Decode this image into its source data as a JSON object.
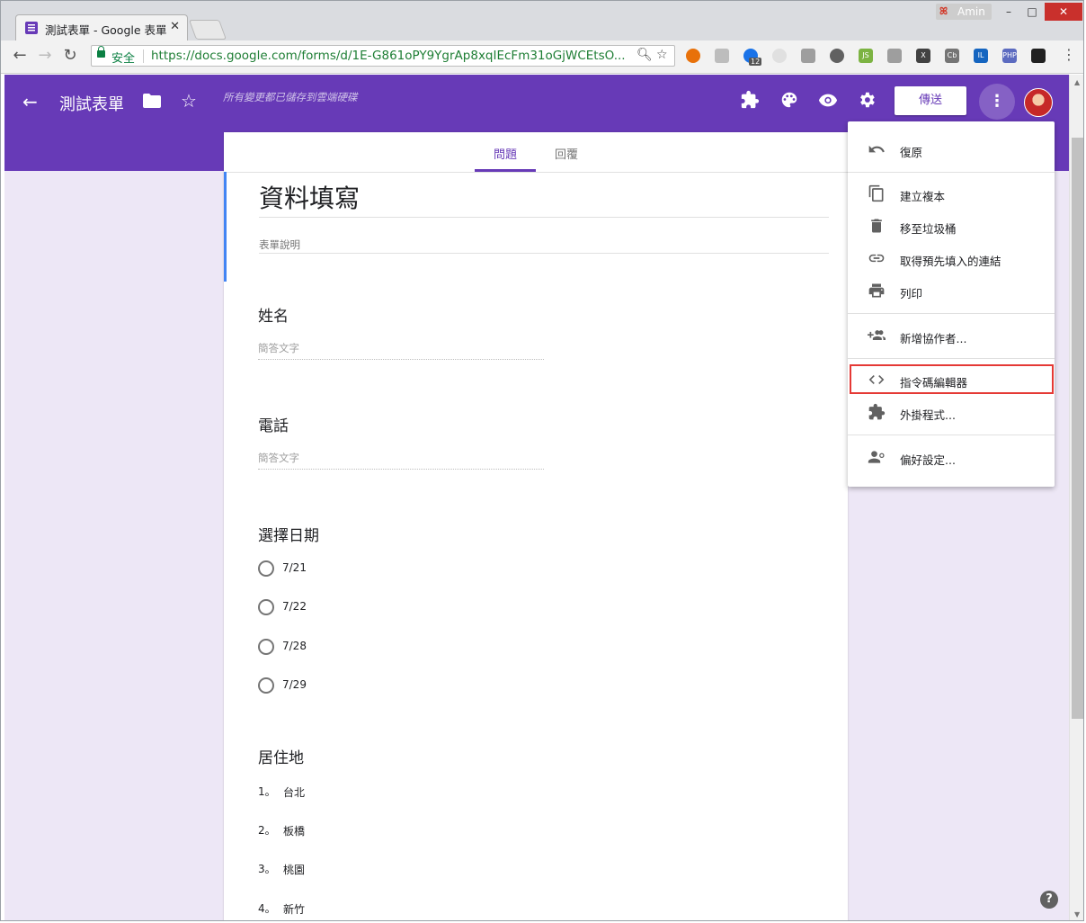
{
  "browser": {
    "tab_title": "測試表單 - Google 表單",
    "tab_close": "✕",
    "user_name": "Amin",
    "user_icon": "ꕤ",
    "security_label": "安全",
    "url": "https://docs.google.com/forms/d/1E-G861oPY9YgrAp8xqIEcFm31oGjWCEtsO...",
    "extension_badge": "12",
    "extensions": [
      "ext-orange",
      "ext-gray",
      "ext-blue-gear",
      "ext-gray2",
      "ext-pdf",
      "ext-eye",
      "ext-js",
      "ext-shield",
      "ext-x",
      "ext-cb",
      "ext-il",
      "ext-php",
      "ext-terminal"
    ],
    "ext_labels": {
      "x": "X",
      "cb": "Cb",
      "il": "IL",
      "php": "PHP",
      "js": "JS"
    }
  },
  "app": {
    "title": "測試表單",
    "saved_status": "所有變更都已儲存到雲端硬碟",
    "send_label": "傳送",
    "accent": "#673ab7"
  },
  "tabs": {
    "questions": "問題",
    "responses": "回覆"
  },
  "form": {
    "title": "資料填寫",
    "description_placeholder": "表單說明",
    "questions": [
      {
        "title": "姓名",
        "type": "short",
        "placeholder": "簡答文字"
      },
      {
        "title": "電話",
        "type": "short",
        "placeholder": "簡答文字"
      },
      {
        "title": "選擇日期",
        "type": "radio",
        "options": [
          "7/21",
          "7/22",
          "7/28",
          "7/29"
        ]
      },
      {
        "title": "居住地",
        "type": "dropdown",
        "options": [
          {
            "num": "1。",
            "label": "台北"
          },
          {
            "num": "2。",
            "label": "板橋"
          },
          {
            "num": "3。",
            "label": "桃園"
          },
          {
            "num": "4。",
            "label": "新竹"
          }
        ]
      }
    ]
  },
  "menu": {
    "items": [
      {
        "label": "復原",
        "icon": "undo-icon"
      },
      {
        "label": "建立複本",
        "icon": "copy-icon"
      },
      {
        "label": "移至垃圾桶",
        "icon": "trash-icon"
      },
      {
        "label": "取得預先填入的連結",
        "icon": "link-icon"
      },
      {
        "label": "列印",
        "icon": "print-icon"
      },
      {
        "label": "新增協作者...",
        "icon": "add-people-icon"
      },
      {
        "label": "指令碼編輯器",
        "icon": "code-icon",
        "highlighted": true
      },
      {
        "label": "外掛程式...",
        "icon": "puzzle-icon"
      },
      {
        "label": "偏好設定...",
        "icon": "person-settings-icon"
      }
    ],
    "highlight_color": "#e53935"
  }
}
